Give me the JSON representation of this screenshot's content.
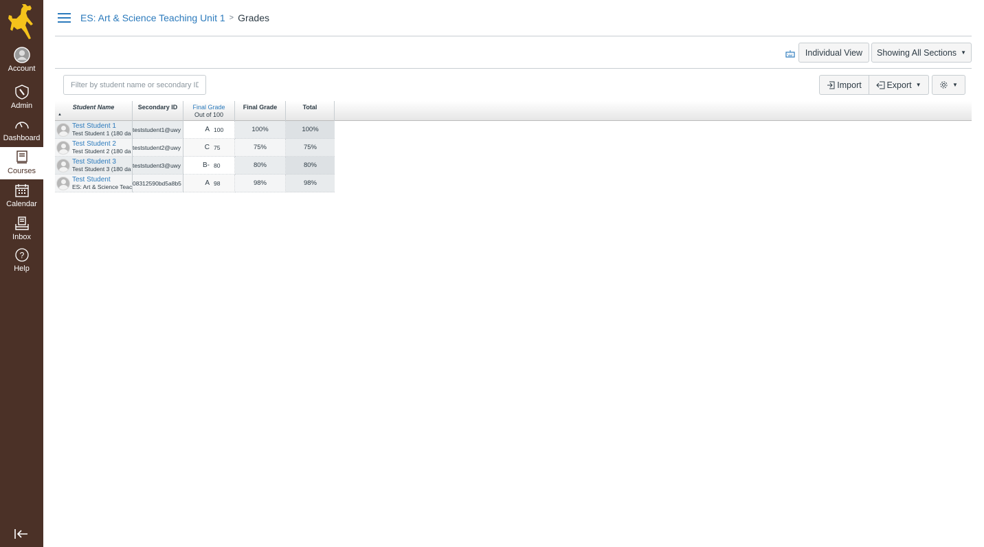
{
  "nav": {
    "logo": "wyoming-bucking-horse-logo",
    "items": [
      {
        "label": "Account",
        "icon": "account-icon"
      },
      {
        "label": "Admin",
        "icon": "admin-icon"
      },
      {
        "label": "Dashboard",
        "icon": "dashboard-icon"
      },
      {
        "label": "Courses",
        "icon": "courses-icon",
        "active": true
      },
      {
        "label": "Calendar",
        "icon": "calendar-icon"
      },
      {
        "label": "Inbox",
        "icon": "inbox-icon"
      },
      {
        "label": "Help",
        "icon": "help-icon"
      }
    ],
    "collapse_icon": "collapse-nav-icon"
  },
  "breadcrumb": {
    "course": "ES: Art & Science Teaching Unit 1",
    "separator": ">",
    "current": "Grades"
  },
  "toolbar": {
    "keyboard_icon": "keyboard-shortcuts-icon",
    "individual_view": "Individual View",
    "sections": "Showing All Sections",
    "import": "Import",
    "export": "Export",
    "settings_icon": "gear-icon"
  },
  "filter": {
    "placeholder": "Filter by student name or secondary ID",
    "value": ""
  },
  "colors": {
    "nav_bg": "#4b3127",
    "accent": "#2b7abc",
    "logo": "#f4c21b"
  },
  "grid": {
    "columns": {
      "student_name": "Student Name",
      "secondary_id": "Secondary ID",
      "assignment": "Final Grade",
      "assignment_sub": "Out of 100",
      "final_grade": "Final Grade",
      "total": "Total",
      "sort_indicator": "▲"
    },
    "rows": [
      {
        "name": "Test Student 1",
        "section": "Test Student 1 (180 da",
        "secondary_id": "teststudent1@uwy",
        "letter": "A",
        "score": "100",
        "final": "100%",
        "total": "100%"
      },
      {
        "name": "Test Student 2",
        "section": "Test Student 2 (180 da",
        "secondary_id": "teststudent2@uwy",
        "letter": "C",
        "score": "75",
        "final": "75%",
        "total": "75%"
      },
      {
        "name": "Test Student 3",
        "section": "Test Student 3 (180 da",
        "secondary_id": "teststudent3@uwy",
        "letter": "B-",
        "score": "80",
        "final": "80%",
        "total": "80%"
      },
      {
        "name": "Test Student",
        "section": "ES: Art & Science Teac",
        "secondary_id": "08312590bd5a8b5",
        "letter": "A",
        "score": "98",
        "final": "98%",
        "total": "98%"
      }
    ]
  }
}
